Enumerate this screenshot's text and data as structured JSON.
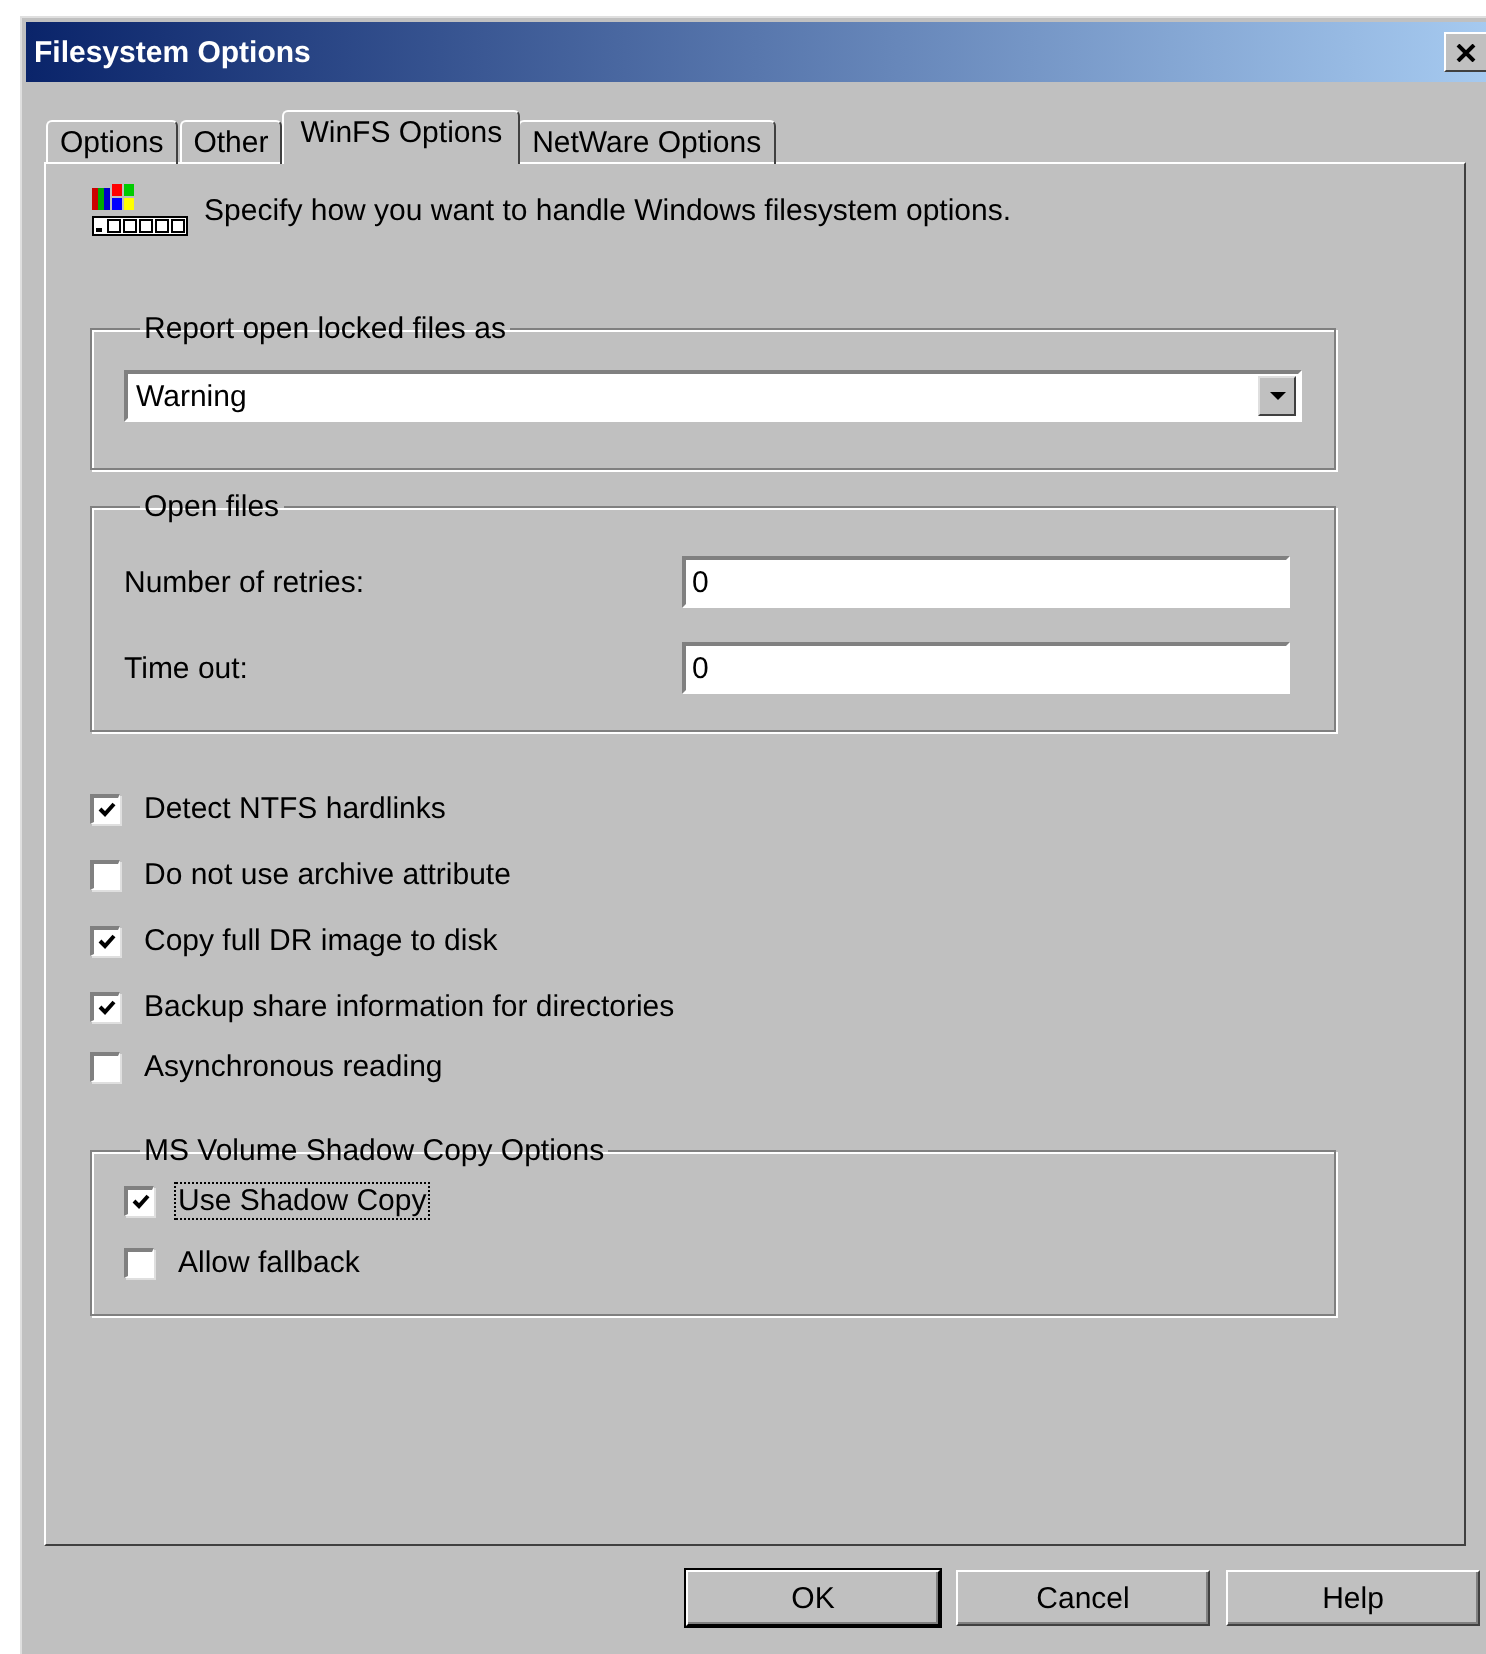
{
  "window": {
    "title": "Filesystem Options"
  },
  "tabs": [
    {
      "label": "Options",
      "selected": false
    },
    {
      "label": "Other",
      "selected": false
    },
    {
      "label": "WinFS Options",
      "selected": true
    },
    {
      "label": "NetWare Options",
      "selected": false
    }
  ],
  "intro": {
    "text": "Specify how you want to handle Windows filesystem options."
  },
  "report_group": {
    "title": "Report open locked files as",
    "dropdown": {
      "value": "Warning"
    }
  },
  "open_files": {
    "title": "Open files",
    "fields": [
      {
        "label": "Number of retries:",
        "value": "0"
      },
      {
        "label": "Time out:",
        "value": "0"
      }
    ]
  },
  "options": [
    {
      "label": "Detect NTFS hardlinks",
      "checked": true
    },
    {
      "label": "Do not use archive attribute",
      "checked": false
    },
    {
      "label": "Copy full DR image to disk",
      "checked": true
    },
    {
      "label": "Backup share information for directories",
      "checked": true
    },
    {
      "label": "Asynchronous reading",
      "checked": false
    }
  ],
  "shadow_copy": {
    "title": "MS Volume Shadow Copy Options",
    "options": [
      {
        "label": "Use Shadow Copy",
        "checked": true,
        "focused": true
      },
      {
        "label": "Allow fallback",
        "checked": false,
        "focused": false
      }
    ]
  },
  "buttons": [
    {
      "label": "OK",
      "default": true
    },
    {
      "label": "Cancel",
      "default": false
    },
    {
      "label": "Help",
      "default": false
    }
  ]
}
